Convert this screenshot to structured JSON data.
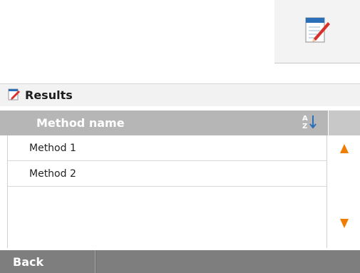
{
  "toolbar": {
    "edit_icon": "notepad-pencil-icon"
  },
  "results": {
    "title": "Results",
    "title_icon": "notepad-pencil-icon"
  },
  "list": {
    "column_header": "Method name",
    "sort_icon": "sort-az-icon",
    "rows": [
      {
        "label": "Method 1"
      },
      {
        "label": "Method 2"
      }
    ]
  },
  "scroll": {
    "up_icon": "arrow-up-icon",
    "down_icon": "arrow-down-icon"
  },
  "footer": {
    "back_label": "Back"
  },
  "colors": {
    "accent": "#f07c00",
    "header_bg": "#b6b6b6",
    "footer_bg": "#7e7e7e",
    "edit_red": "#d9302b",
    "edit_blue": "#2a6fb8"
  }
}
